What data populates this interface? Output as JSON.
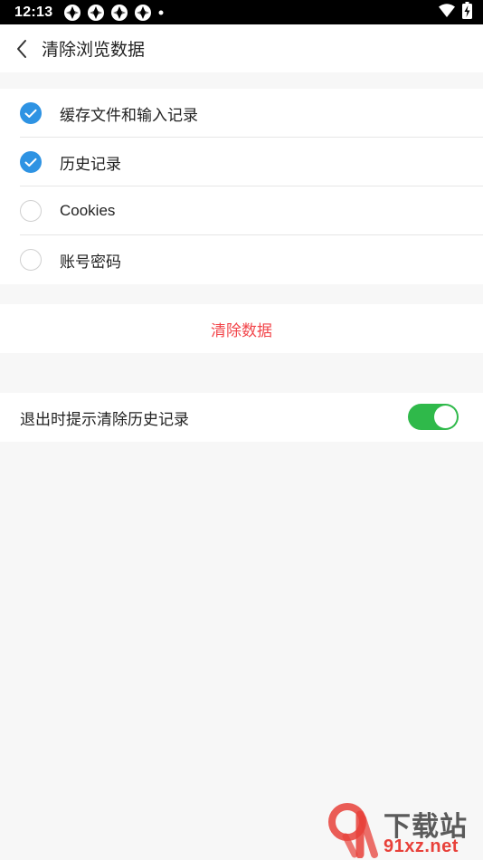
{
  "status_bar": {
    "time": "12:13"
  },
  "header": {
    "title": "清除浏览数据"
  },
  "options": [
    {
      "label": "缓存文件和输入记录",
      "checked": true
    },
    {
      "label": "历史记录",
      "checked": true
    },
    {
      "label": "Cookies",
      "checked": false
    },
    {
      "label": "账号密码",
      "checked": false
    }
  ],
  "clear_button": {
    "label": "清除数据",
    "color": "#f2464b"
  },
  "exit_prompt": {
    "label": "退出时提示清除历史记录",
    "enabled": true,
    "toggle_color": "#2fb94a"
  },
  "watermark": {
    "text_cn": "下载站",
    "url": "91xz.net"
  },
  "colors": {
    "accent": "#2e93e3",
    "background": "#f7f7f7"
  }
}
